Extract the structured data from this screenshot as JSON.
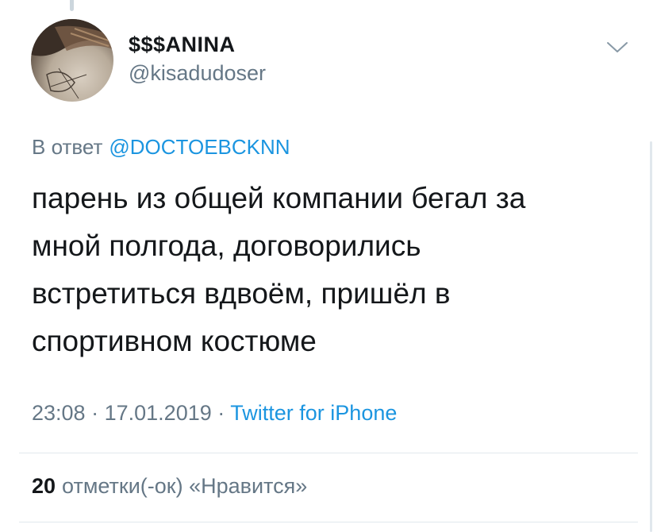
{
  "tweet": {
    "display_name": "$$$ANINA",
    "username": "@kisadudoser",
    "reply_prefix": "В ответ",
    "reply_mention": "@DOCTOEBCKNN",
    "text_lines": [
      "парень из общей компании бегал за",
      "мной полгода, договорились",
      "встретиться вдвоём, пришёл в",
      "спортивном костюме"
    ],
    "time": "23:08",
    "separator": "·",
    "date": "17.01.2019",
    "source": "Twitter for iPhone",
    "likes_count": "20",
    "likes_label": "отметки(-ок) «Нравится»"
  },
  "icons": {
    "menu": "chevron-down-icon",
    "avatar": "profile-photo"
  },
  "colors": {
    "link": "#1b95e0",
    "secondary_text": "#657786",
    "primary_text": "#14171a",
    "divider": "#e1e8ed"
  }
}
